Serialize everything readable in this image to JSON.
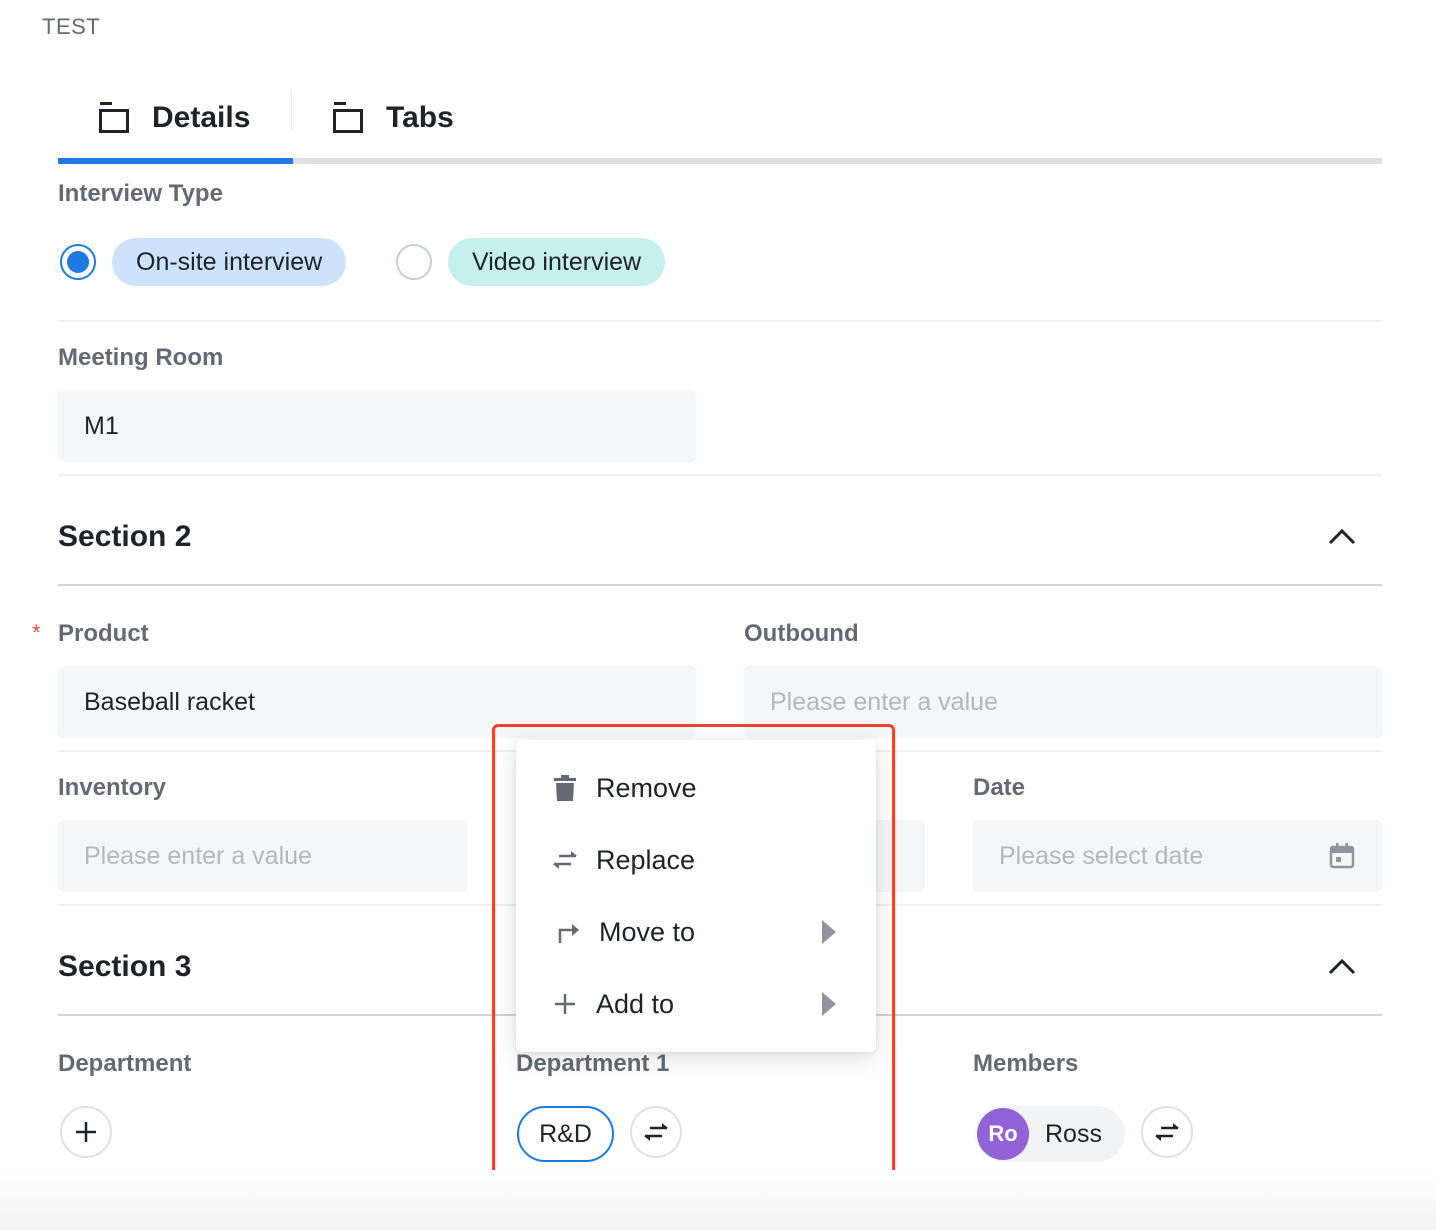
{
  "app": {
    "title": "TEST"
  },
  "tabs": [
    {
      "label": "Details",
      "icon": "window-icon",
      "active": true
    },
    {
      "label": "Tabs",
      "icon": "window-icon",
      "active": false
    }
  ],
  "interview_type": {
    "label": "Interview Type",
    "options": [
      {
        "label": "On-site interview",
        "selected": true,
        "color": "#cce3fb"
      },
      {
        "label": "Video interview",
        "selected": false,
        "color": "#c6f0ee"
      }
    ]
  },
  "meeting_room": {
    "label": "Meeting Room",
    "value": "M1"
  },
  "section2": {
    "title": "Section 2",
    "product": {
      "label": "Product",
      "required_mark": "*",
      "value": "Baseball racket"
    },
    "outbound": {
      "label": "Outbound",
      "placeholder": "Please enter a value"
    },
    "inventory": {
      "label": "Inventory",
      "placeholder": "Please enter a value"
    },
    "date": {
      "label": "Date",
      "placeholder": "Please select date"
    }
  },
  "section3": {
    "title": "Section 3",
    "department": {
      "label": "Department"
    },
    "department1": {
      "label": "Department 1",
      "tag": "R&D"
    },
    "members": {
      "label": "Members",
      "member": {
        "initials": "Ro",
        "name": "Ross",
        "avatar_color": "#9263d6"
      }
    }
  },
  "context_menu": {
    "items": [
      {
        "label": "Remove",
        "icon": "trash-icon",
        "submenu": false
      },
      {
        "label": "Replace",
        "icon": "swap-icon",
        "submenu": false
      },
      {
        "label": "Move to",
        "icon": "turn-right-arrow-icon",
        "submenu": true
      },
      {
        "label": "Add to",
        "icon": "plus-icon",
        "submenu": true
      }
    ]
  },
  "colors": {
    "accent": "#1f7ae0",
    "highlight": "#e8462e",
    "required": "#f54a45"
  }
}
